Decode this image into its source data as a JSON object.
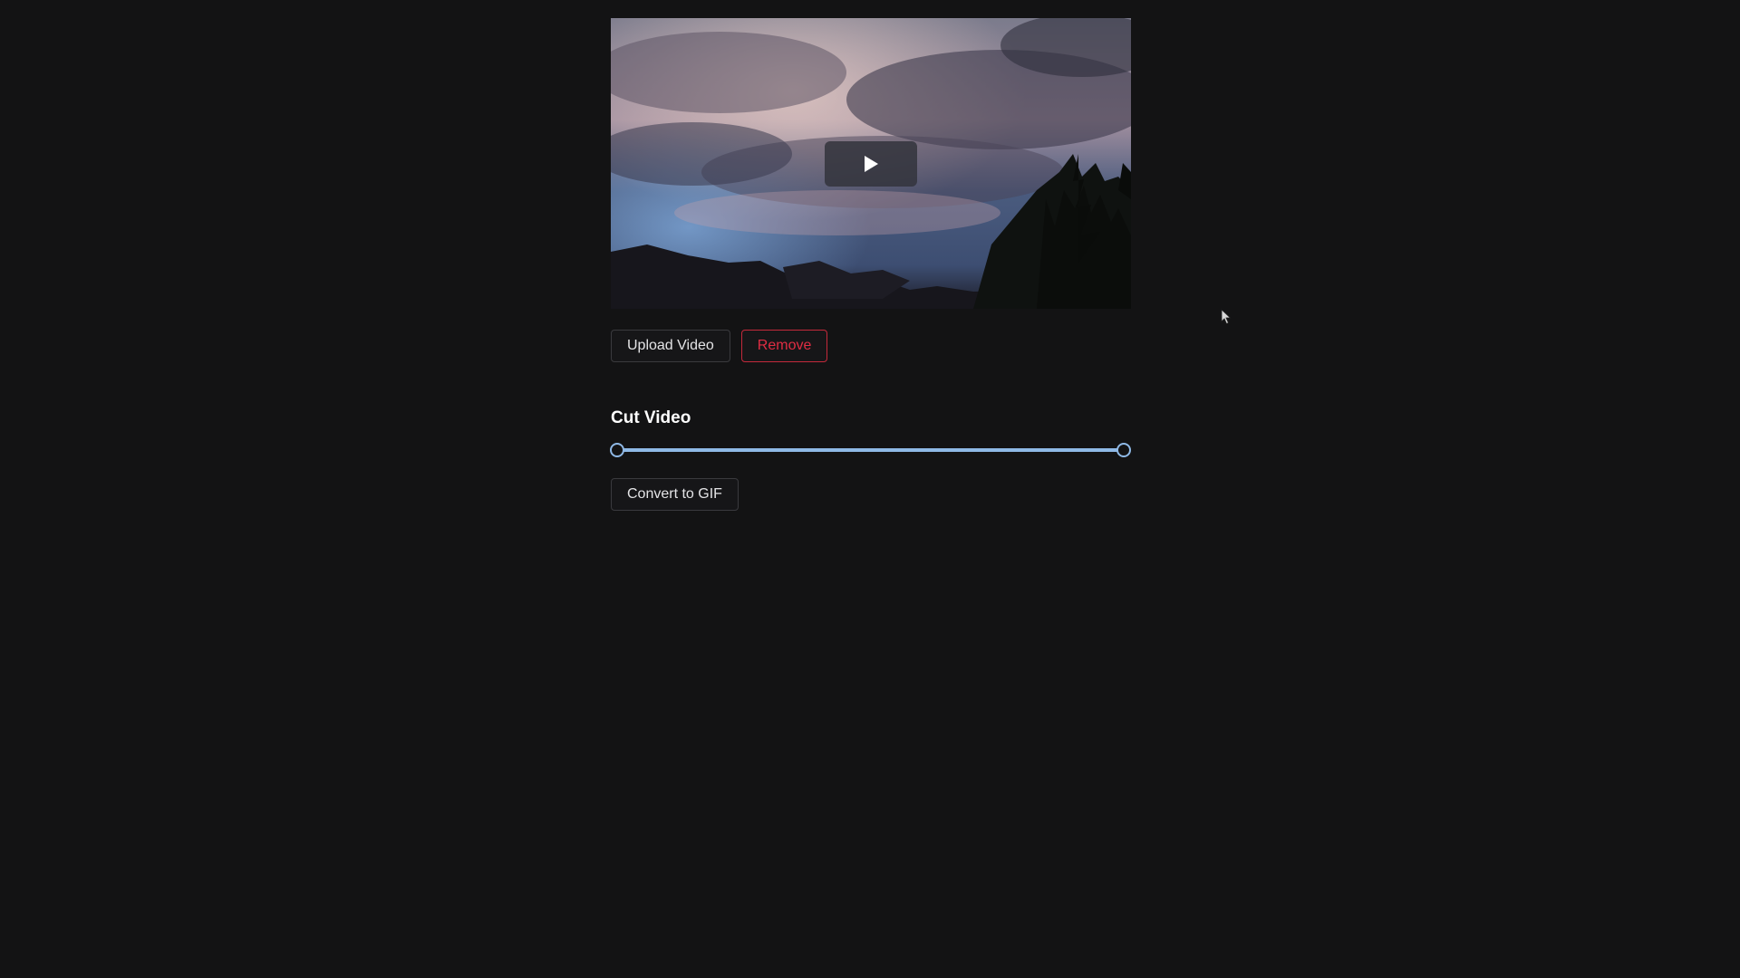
{
  "video": {
    "play_icon": "play-icon"
  },
  "actions": {
    "upload_label": "Upload Video",
    "remove_label": "Remove"
  },
  "cut": {
    "title": "Cut Video",
    "range_start": 0,
    "range_end": 1
  },
  "convert": {
    "label": "Convert to GIF"
  },
  "colors": {
    "background": "#131314",
    "accent": "#8fb9e6",
    "danger": "#e02d43"
  }
}
